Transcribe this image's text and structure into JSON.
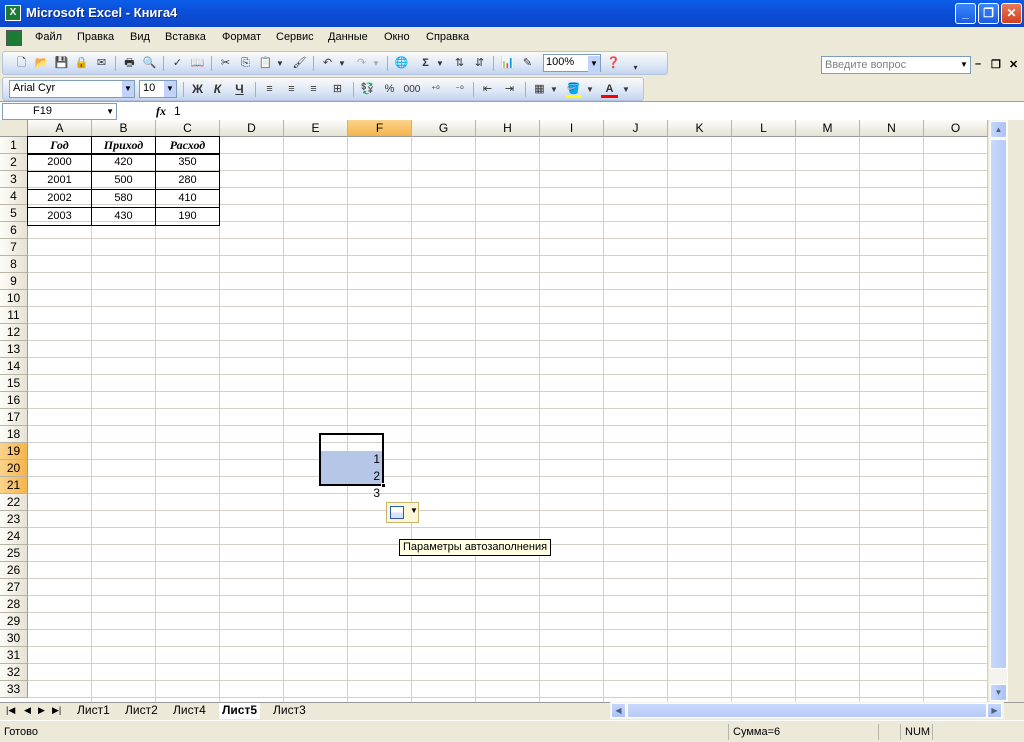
{
  "window": {
    "title": "Microsoft Excel - Книга4",
    "app_icon": "X",
    "min": "_",
    "max": "❐",
    "close": "✕"
  },
  "menu": [
    "Файл",
    "Правка",
    "Вид",
    "Вставка",
    "Формат",
    "Сервис",
    "Данные",
    "Окно",
    "Справка"
  ],
  "help": {
    "placeholder": "Введите вопрос",
    "drop": "▼",
    "mdi_min": "–",
    "mdi_restore": "❐",
    "mdi_close": "✕"
  },
  "toolbar": {
    "zoom": "100%",
    "font_name": "Arial Cyr",
    "font_size": "10",
    "bold": "Ж",
    "italic": "К",
    "underline": "Ч",
    "percent": "%",
    "thousands": "000",
    "sum": "Σ"
  },
  "formula": {
    "namebox": "F19",
    "fx": "fx",
    "value": "1"
  },
  "columns": [
    "A",
    "B",
    "C",
    "D",
    "E",
    "F",
    "G",
    "H",
    "I",
    "J",
    "K",
    "L",
    "M",
    "N",
    "O"
  ],
  "selected_column": "F",
  "rows": [
    "1",
    "2",
    "3",
    "4",
    "5",
    "6",
    "7",
    "8",
    "9",
    "10",
    "11",
    "12",
    "13",
    "14",
    "15",
    "16",
    "17",
    "18",
    "19",
    "20",
    "21",
    "22",
    "23",
    "24",
    "25",
    "26",
    "27",
    "28",
    "29",
    "30",
    "31",
    "32",
    "33"
  ],
  "selected_rows": [
    "19",
    "20",
    "21"
  ],
  "table": {
    "headers": [
      "Год",
      "Приход",
      "Расход"
    ],
    "rows": [
      [
        "2000",
        "420",
        "350"
      ],
      [
        "2001",
        "500",
        "280"
      ],
      [
        "2002",
        "580",
        "410"
      ],
      [
        "2003",
        "430",
        "190"
      ]
    ]
  },
  "fill_values": [
    "1",
    "2",
    "3"
  ],
  "autofill_tooltip": "Параметры автозаполнения",
  "sheets": [
    "Лист1",
    "Лист2",
    "Лист4",
    "Лист5",
    "Лист3"
  ],
  "active_sheet": "Лист5",
  "status": {
    "ready": "Готово",
    "sum": "Сумма=6",
    "num": "NUM"
  }
}
